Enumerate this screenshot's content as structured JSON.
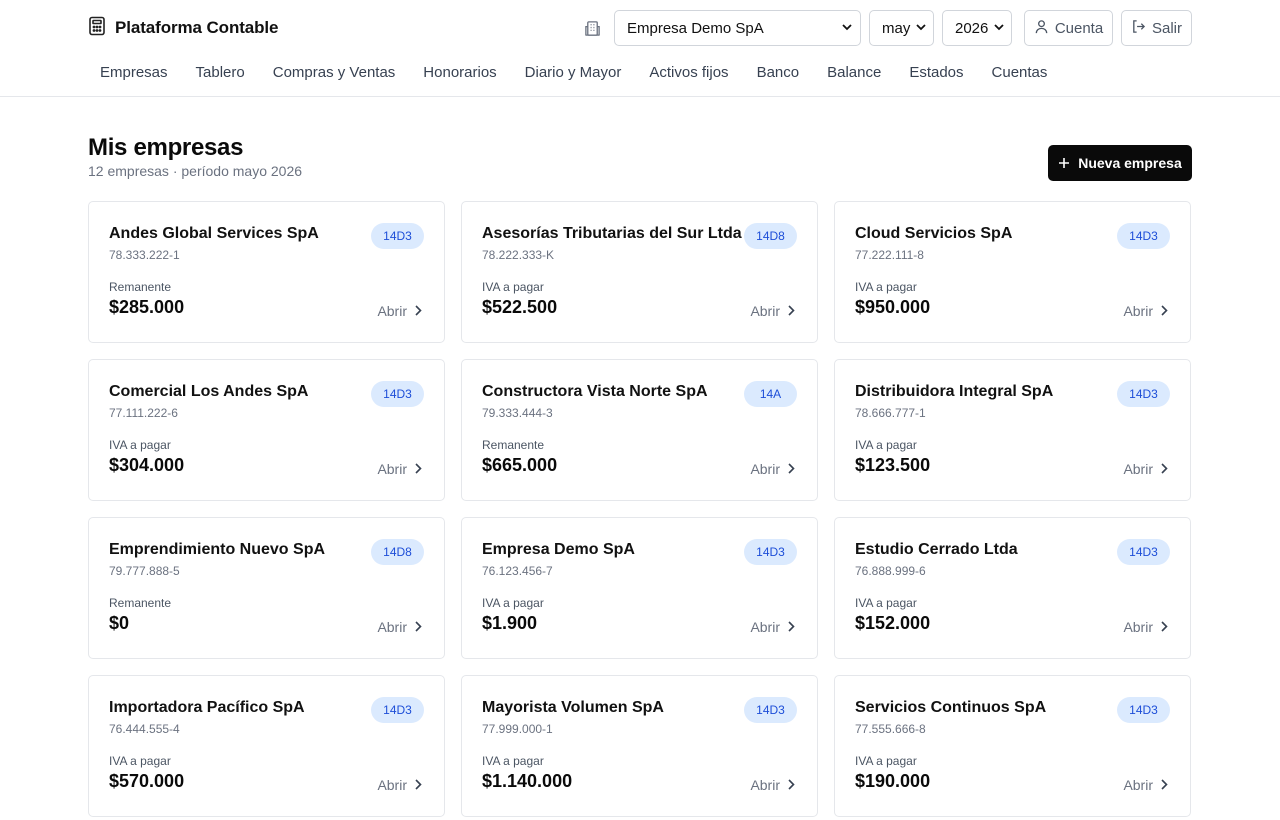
{
  "app": {
    "title": "Plataforma Contable"
  },
  "header": {
    "company_select": "Empresa Demo SpA",
    "month_select": "may",
    "year_select": "2026",
    "account_label": "Cuenta",
    "exit_label": "Salir"
  },
  "nav": [
    "Empresas",
    "Tablero",
    "Compras y Ventas",
    "Honorarios",
    "Diario y Mayor",
    "Activos fijos",
    "Banco",
    "Balance",
    "Estados",
    "Cuentas"
  ],
  "page": {
    "title": "Mis empresas",
    "subtitle": "12 empresas · período mayo 2026",
    "new_button": "Nueva empresa"
  },
  "companies": [
    {
      "name": "Andes Global Services SpA",
      "rut": "78.333.222-1",
      "regime": "14D3",
      "label": "Remanente",
      "amount": "$285.000",
      "open": "Abrir"
    },
    {
      "name": "Asesorías Tributarias del Sur Ltda",
      "rut": "78.222.333-K",
      "regime": "14D8",
      "label": "IVA a pagar",
      "amount": "$522.500",
      "open": "Abrir"
    },
    {
      "name": "Cloud Servicios SpA",
      "rut": "77.222.111-8",
      "regime": "14D3",
      "label": "IVA a pagar",
      "amount": "$950.000",
      "open": "Abrir"
    },
    {
      "name": "Comercial Los Andes SpA",
      "rut": "77.111.222-6",
      "regime": "14D3",
      "label": "IVA a pagar",
      "amount": "$304.000",
      "open": "Abrir"
    },
    {
      "name": "Constructora Vista Norte SpA",
      "rut": "79.333.444-3",
      "regime": "14A",
      "label": "Remanente",
      "amount": "$665.000",
      "open": "Abrir"
    },
    {
      "name": "Distribuidora Integral SpA",
      "rut": "78.666.777-1",
      "regime": "14D3",
      "label": "IVA a pagar",
      "amount": "$123.500",
      "open": "Abrir"
    },
    {
      "name": "Emprendimiento Nuevo SpA",
      "rut": "79.777.888-5",
      "regime": "14D8",
      "label": "Remanente",
      "amount": "$0",
      "open": "Abrir"
    },
    {
      "name": "Empresa Demo SpA",
      "rut": "76.123.456-7",
      "regime": "14D3",
      "label": "IVA a pagar",
      "amount": "$1.900",
      "open": "Abrir"
    },
    {
      "name": "Estudio Cerrado Ltda",
      "rut": "76.888.999-6",
      "regime": "14D3",
      "label": "IVA a pagar",
      "amount": "$152.000",
      "open": "Abrir"
    },
    {
      "name": "Importadora Pacífico SpA",
      "rut": "76.444.555-4",
      "regime": "14D3",
      "label": "IVA a pagar",
      "amount": "$570.000",
      "open": "Abrir"
    },
    {
      "name": "Mayorista Volumen SpA",
      "rut": "77.999.000-1",
      "regime": "14D3",
      "label": "IVA a pagar",
      "amount": "$1.140.000",
      "open": "Abrir"
    },
    {
      "name": "Servicios Continuos SpA",
      "rut": "77.555.666-8",
      "regime": "14D3",
      "label": "IVA a pagar",
      "amount": "$190.000",
      "open": "Abrir"
    }
  ],
  "colors": {
    "badge_bg": "#dbeafe",
    "badge_text": "#1d4ed8",
    "primary_button": "#0a0a0a"
  },
  "icons": {
    "brand": "calculator-icon",
    "company": "building-icon",
    "account": "user-icon",
    "exit": "logout-icon",
    "add": "plus-icon",
    "open": "chevron-right-icon"
  }
}
